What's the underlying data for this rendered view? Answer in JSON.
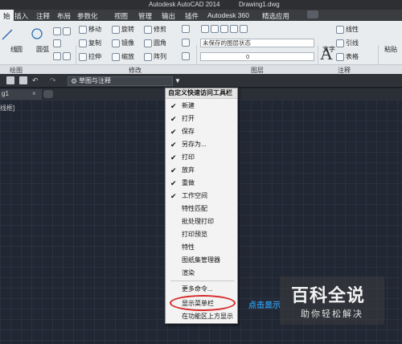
{
  "window": {
    "title": "Autodesk AutoCAD 2014",
    "file": "Drawing1.dwg"
  },
  "menubar": {
    "items": [
      "插入",
      "注释",
      "布局",
      "参数化",
      "视图",
      "管理",
      "输出",
      "插件",
      "Autodesk 360",
      "精选应用"
    ],
    "active_partial": "始"
  },
  "ribbon": {
    "draw_labels": [
      "线",
      "圆",
      "圆弧"
    ],
    "modify": [
      {
        "label": "移动"
      },
      {
        "label": "旋转"
      },
      {
        "label": "修剪"
      },
      {
        "label": "复制"
      },
      {
        "label": "镜像"
      },
      {
        "label": "圆角"
      },
      {
        "label": "拉伸"
      },
      {
        "label": "缩放"
      },
      {
        "label": "阵列"
      }
    ],
    "layer_state": "未保存的图层状态",
    "layer_current": "0",
    "text_label": "文字",
    "annotation": [
      {
        "label": "线性"
      },
      {
        "label": "引线"
      },
      {
        "label": "表格"
      }
    ],
    "far_right": "粘贴",
    "panel_titles": {
      "draw": "绘图",
      "modify": "修改",
      "layers": "图层",
      "annotation": "注释"
    }
  },
  "qat": {
    "workspace": "草图与注释"
  },
  "tabs": {
    "doc": "g1"
  },
  "canvas": {
    "label": "线框]"
  },
  "dropdown": {
    "header": "自定义快速访问工具栏",
    "items": [
      {
        "label": "新建",
        "checked": true
      },
      {
        "label": "打开",
        "checked": true
      },
      {
        "label": "保存",
        "checked": true
      },
      {
        "label": "另存为...",
        "checked": true
      },
      {
        "label": "打印",
        "checked": true
      },
      {
        "label": "放弃",
        "checked": true
      },
      {
        "label": "重做",
        "checked": true
      },
      {
        "label": "工作空间",
        "checked": true
      },
      {
        "label": "特性匹配",
        "checked": false
      },
      {
        "label": "批处理打印",
        "checked": false
      },
      {
        "label": "打印预览",
        "checked": false
      },
      {
        "label": "特性",
        "checked": false
      },
      {
        "label": "图纸集管理器",
        "checked": false
      },
      {
        "label": "渲染",
        "checked": false
      },
      {
        "label": "更多命令...",
        "checked": false
      },
      {
        "label": "显示菜单栏",
        "checked": false
      },
      {
        "label": "在功能区上方显示",
        "checked": false
      }
    ]
  },
  "hint": "点击显示",
  "watermark": {
    "title": "百科全说",
    "subtitle": "助你轻松解决"
  },
  "colors": {
    "highlight_circle": "#d62b2b",
    "hint_text": "#2f8fd6"
  }
}
